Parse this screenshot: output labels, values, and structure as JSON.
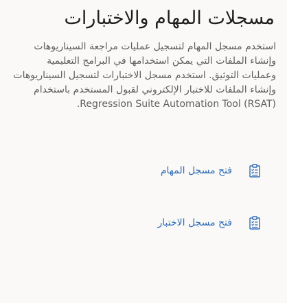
{
  "panel": {
    "title": "مسجلات المهام والاختبارات",
    "description": "استخدم مسجل المهام لتسجيل عمليات مراجعة السيناريوهات وإنشاء الملفات التي يمكن استخدامها في البرامج التعليمية وعمليات التوثيق. استخدم مسجل الاختبارات لتسجيل السيناريوهات وإنشاء الملفات للاختبار الإلكتروني لقبول المستخدم باستخدام Regression Suite Automation Tool (RSAT).",
    "links": [
      {
        "label": "فتح مسجل المهام",
        "icon": "clipboard-checklist-icon"
      },
      {
        "label": "فتح مسجل الاختبار",
        "icon": "clipboard-checklist-icon"
      }
    ]
  },
  "colors": {
    "background": "#faf9f8",
    "title_text": "#201f1e",
    "body_text": "#605e5c",
    "link": "#2f6db5"
  }
}
